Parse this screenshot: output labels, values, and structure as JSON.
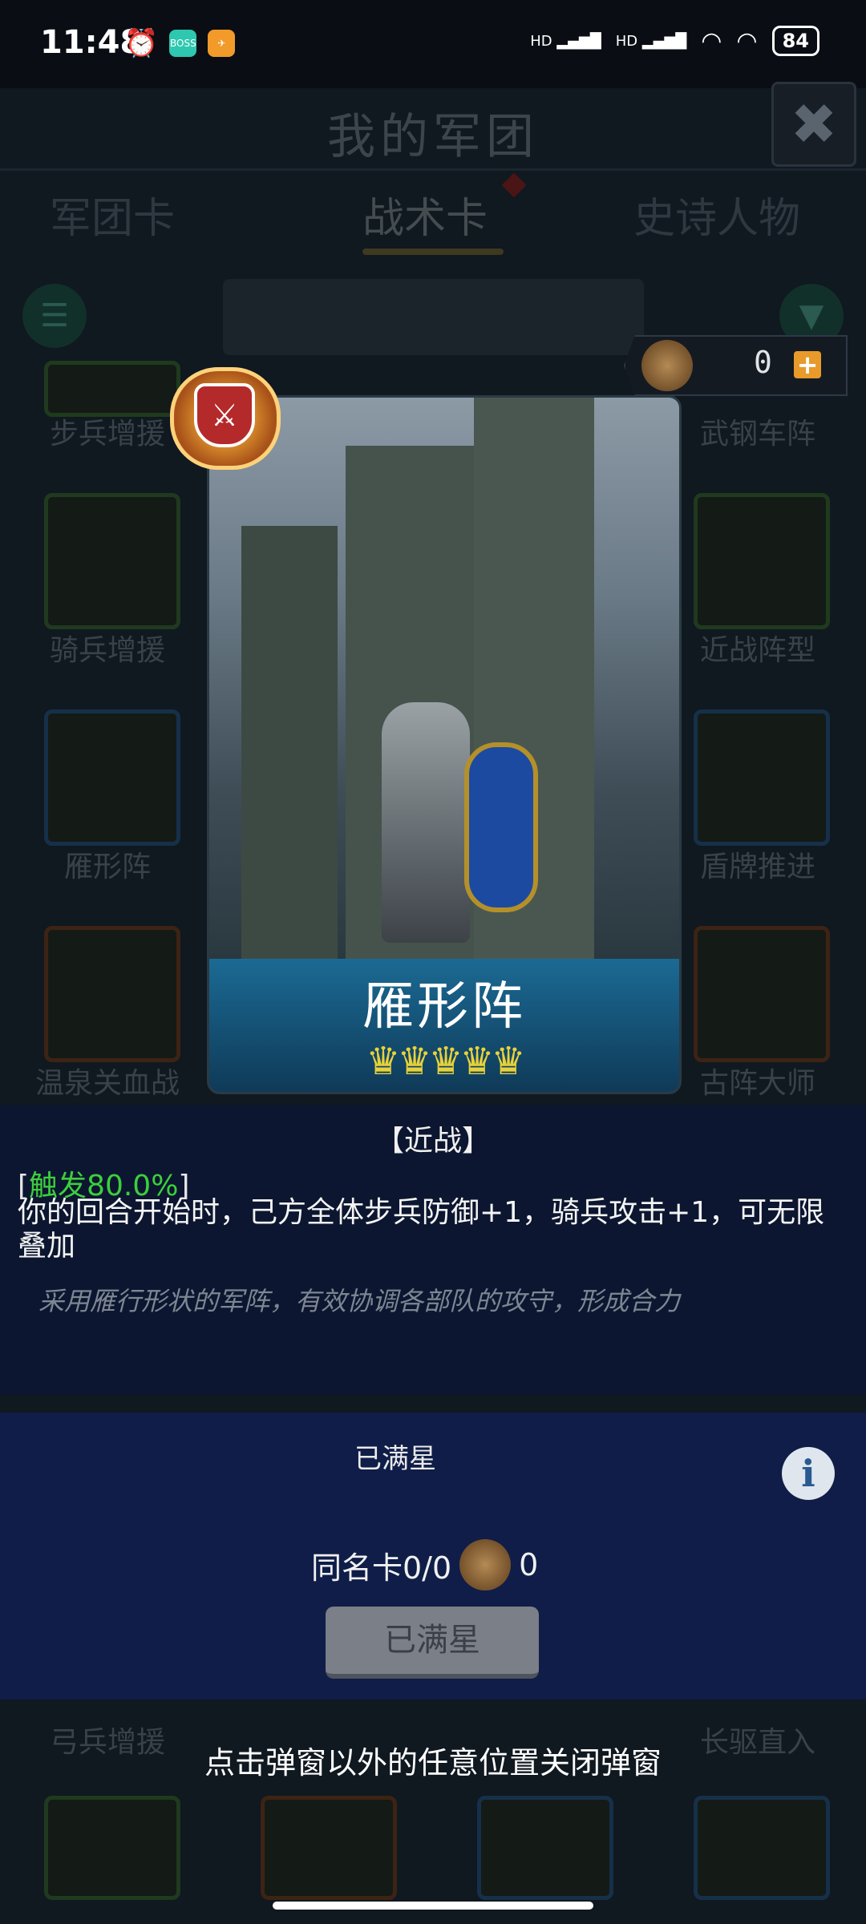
{
  "status": {
    "time": "11:48",
    "battery": "84",
    "network1": "HD",
    "network2": "HD",
    "app1": "BOSS"
  },
  "screen": {
    "title": "我的军团",
    "close": "✖",
    "tabs": [
      "军团卡",
      "战术卡",
      "史诗人物"
    ],
    "grid_labels": {
      "r1": [
        "步兵增援",
        "武钢车阵"
      ],
      "r2": [
        "骑兵增援",
        "近战阵型"
      ],
      "r3": [
        "雁形阵",
        "盾牌推进"
      ],
      "r4": [
        "温泉关血战",
        "古阵大师"
      ],
      "r5": [
        "弓兵增援",
        "长驱直入"
      ]
    }
  },
  "currency": {
    "amount": "0",
    "plus": "+"
  },
  "card": {
    "name": "雁形阵",
    "stars": "♛♛♛♛♛",
    "badge_icon": "⚔"
  },
  "description": {
    "type": "【近战】",
    "trigger_open": "[",
    "trigger_text": "触发80.0%",
    "trigger_close": "]",
    "effect": "你的回合开始时，己方全体步兵防御+1，骑兵攻击+1，可无限叠加",
    "flavor": "采用雁行形状的军阵，有效协调各部队的攻守，形成合力"
  },
  "star_panel": {
    "status": "已满星",
    "info": "i",
    "same_card_label": "同名卡0/0",
    "same_card_count": "0",
    "button": "已满星"
  },
  "hint": "点击弹窗以外的任意位置关闭弹窗"
}
